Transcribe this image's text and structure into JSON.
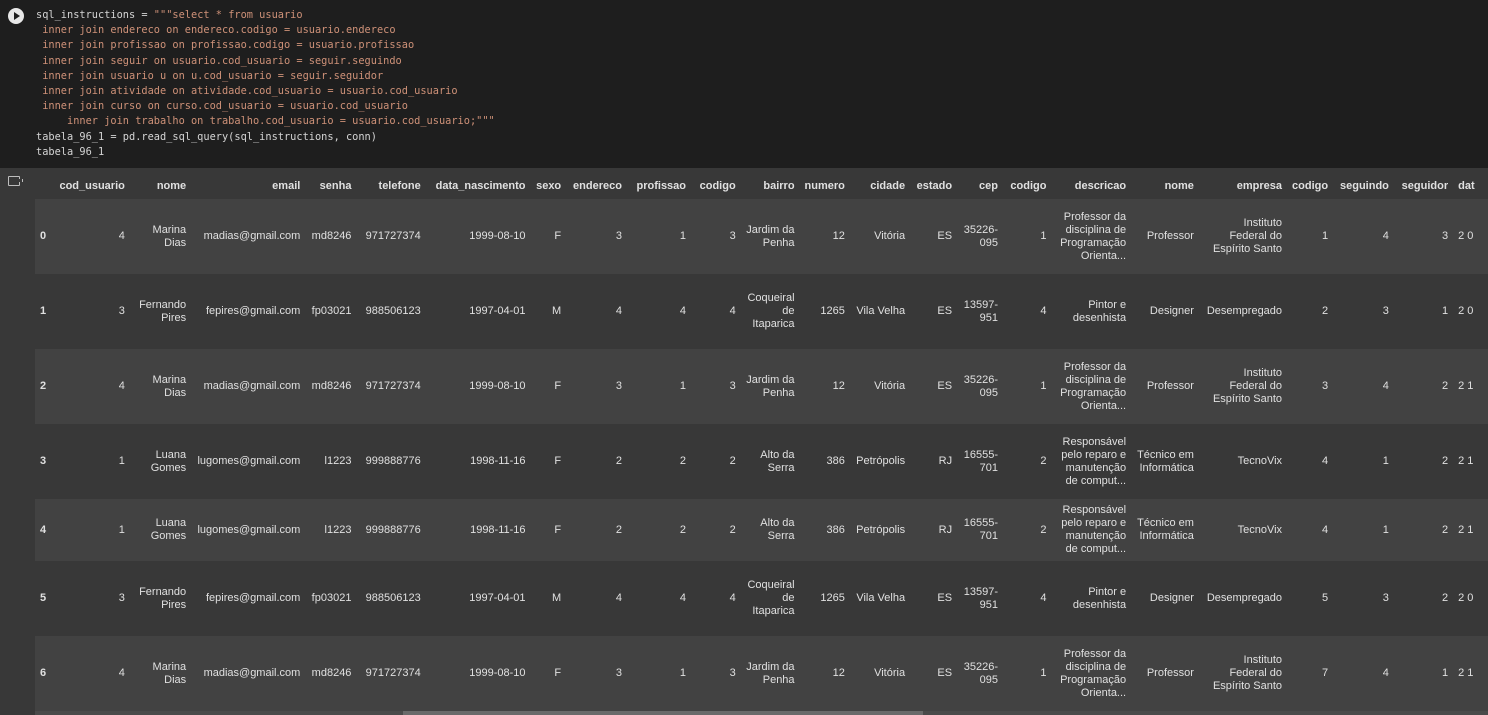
{
  "code": {
    "line1_a": "sql_instructions = ",
    "line1_b": "\"\"\"select * from usuario",
    "sql_lines": [
      " inner join endereco on endereco.codigo = usuario.endereco",
      " inner join profissao on profissao.codigo = usuario.profissao",
      " inner join seguir on usuario.cod_usuario = seguir.seguindo",
      " inner join usuario u on u.cod_usuario = seguir.seguidor",
      " inner join atividade on atividade.cod_usuario = usuario.cod_usuario",
      " inner join curso on curso.cod_usuario = usuario.cod_usuario",
      "     inner join trabalho on trabalho.cod_usuario = usuario.cod_usuario;\"\"\""
    ],
    "line9": "tabela_96_1 = pd.read_sql_query(sql_instructions, conn)",
    "line10": "tabela_96_1"
  },
  "table": {
    "columns": [
      "",
      "cod_usuario",
      "nome",
      "email",
      "senha",
      "telefone",
      "data_nascimento",
      "sexo",
      "endereco",
      "profissao",
      "codigo",
      "bairro",
      "numero",
      "cidade",
      "estado",
      "cep",
      "codigo",
      "descricao",
      "nome",
      "empresa",
      "codigo",
      "seguindo",
      "seguidor",
      "dat"
    ],
    "rows": [
      [
        "0",
        "4",
        "Marina Dias",
        "madias@gmail.com",
        "md8246",
        "971727374",
        "1999-08-10",
        "F",
        "3",
        "1",
        "3",
        "Jardim da Penha",
        "12",
        "Vitória",
        "ES",
        "35226-095",
        "1",
        "Professor da disciplina de Programação Orienta...",
        "Professor",
        "Instituto Federal do Espírito Santo",
        "1",
        "4",
        "3",
        "2 0"
      ],
      [
        "1",
        "3",
        "Fernando Pires",
        "fepires@gmail.com",
        "fp03021",
        "988506123",
        "1997-04-01",
        "M",
        "4",
        "4",
        "4",
        "Coqueiral de Itaparica",
        "1265",
        "Vila Velha",
        "ES",
        "13597-951",
        "4",
        "Pintor e desenhista",
        "Designer",
        "Desempregado",
        "2",
        "3",
        "1",
        "2 0"
      ],
      [
        "2",
        "4",
        "Marina Dias",
        "madias@gmail.com",
        "md8246",
        "971727374",
        "1999-08-10",
        "F",
        "3",
        "1",
        "3",
        "Jardim da Penha",
        "12",
        "Vitória",
        "ES",
        "35226-095",
        "1",
        "Professor da disciplina de Programação Orienta...",
        "Professor",
        "Instituto Federal do Espírito Santo",
        "3",
        "4",
        "2",
        "2 1"
      ],
      [
        "3",
        "1",
        "Luana Gomes",
        "lugomes@gmail.com",
        "l1223",
        "999888776",
        "1998-11-16",
        "F",
        "2",
        "2",
        "2",
        "Alto da Serra",
        "386",
        "Petrópolis",
        "RJ",
        "16555-701",
        "2",
        "Responsável pelo reparo e manutenção de comput...",
        "Técnico em Informática",
        "TecnoVix",
        "4",
        "1",
        "2",
        "2 1"
      ],
      [
        "4",
        "1",
        "Luana Gomes",
        "lugomes@gmail.com",
        "l1223",
        "999888776",
        "1998-11-16",
        "F",
        "2",
        "2",
        "2",
        "Alto da Serra",
        "386",
        "Petrópolis",
        "RJ",
        "16555-701",
        "2",
        "Responsável pelo reparo e manutenção de comput...",
        "Técnico em Informática",
        "TecnoVix",
        "4",
        "1",
        "2",
        "2 1"
      ],
      [
        "5",
        "3",
        "Fernando Pires",
        "fepires@gmail.com",
        "fp03021",
        "988506123",
        "1997-04-01",
        "M",
        "4",
        "4",
        "4",
        "Coqueiral de Itaparica",
        "1265",
        "Vila Velha",
        "ES",
        "13597-951",
        "4",
        "Pintor e desenhista",
        "Designer",
        "Desempregado",
        "5",
        "3",
        "2",
        "2 0"
      ],
      [
        "6",
        "4",
        "Marina Dias",
        "madias@gmail.com",
        "md8246",
        "971727374",
        "1999-08-10",
        "F",
        "3",
        "1",
        "3",
        "Jardim da Penha",
        "12",
        "Vitória",
        "ES",
        "35226-095",
        "1",
        "Professor da disciplina de Programação Orienta...",
        "Professor",
        "Instituto Federal do Espírito Santo",
        "7",
        "4",
        "1",
        "2 1"
      ]
    ]
  }
}
